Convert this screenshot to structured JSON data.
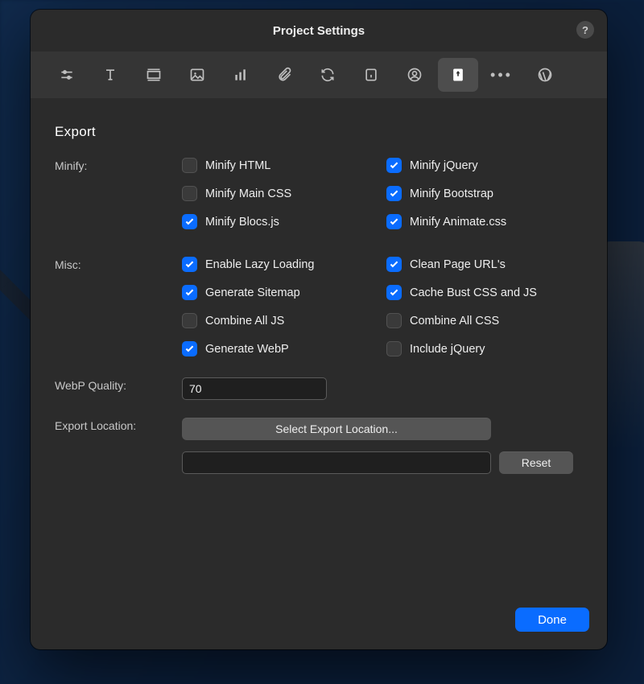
{
  "modal": {
    "title": "Project Settings",
    "help_tooltip": "?"
  },
  "toolbar": {
    "tabs": [
      {
        "id": "sliders",
        "icon": "sliders-icon",
        "active": false
      },
      {
        "id": "typography",
        "icon": "type-icon",
        "active": false
      },
      {
        "id": "layout",
        "icon": "layout-icon",
        "active": false
      },
      {
        "id": "image",
        "icon": "image-icon",
        "active": false
      },
      {
        "id": "analytics",
        "icon": "chart-icon",
        "active": false
      },
      {
        "id": "attach",
        "icon": "paperclip-icon",
        "active": false
      },
      {
        "id": "sync",
        "icon": "refresh-icon",
        "active": false
      },
      {
        "id": "info",
        "icon": "info-icon",
        "active": false
      },
      {
        "id": "user",
        "icon": "user-icon",
        "active": false
      },
      {
        "id": "export",
        "icon": "export-icon",
        "active": true
      },
      {
        "id": "more",
        "icon": "more-icon",
        "active": false
      },
      {
        "id": "wordpress",
        "icon": "wordpress-icon",
        "active": false
      }
    ]
  },
  "section": {
    "title": "Export"
  },
  "minify": {
    "label": "Minify:",
    "opts": {
      "html": {
        "label": "Minify HTML",
        "checked": false
      },
      "jquery": {
        "label": "Minify jQuery",
        "checked": true
      },
      "maincss": {
        "label": "Minify Main CSS",
        "checked": false
      },
      "bootstrap": {
        "label": "Minify Bootstrap",
        "checked": true
      },
      "blocsjs": {
        "label": "Minify Blocs.js",
        "checked": true
      },
      "animatecss": {
        "label": "Minify Animate.css",
        "checked": true
      }
    }
  },
  "misc": {
    "label": "Misc:",
    "opts": {
      "lazy": {
        "label": "Enable Lazy Loading",
        "checked": true
      },
      "cleanurl": {
        "label": "Clean Page URL's",
        "checked": true
      },
      "sitemap": {
        "label": "Generate Sitemap",
        "checked": true
      },
      "cachebust": {
        "label": "Cache Bust CSS and JS",
        "checked": true
      },
      "combinejs": {
        "label": "Combine All JS",
        "checked": false
      },
      "combinecss": {
        "label": "Combine All CSS",
        "checked": false
      },
      "webp": {
        "label": "Generate WebP",
        "checked": true
      },
      "includejq": {
        "label": "Include jQuery",
        "checked": false
      }
    }
  },
  "webp": {
    "label": "WebP Quality:",
    "value": "70"
  },
  "exportloc": {
    "label": "Export Location:",
    "select_button": "Select Export Location...",
    "path": "",
    "reset": "Reset"
  },
  "footer": {
    "done": "Done"
  }
}
